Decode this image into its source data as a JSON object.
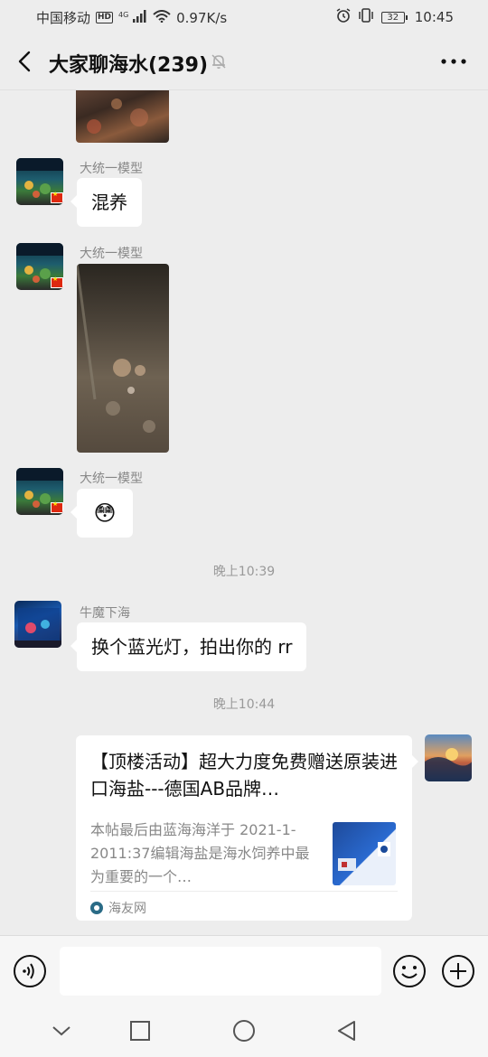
{
  "status_bar": {
    "carrier": "中国移动",
    "hd": "HD",
    "network": "4G",
    "speed": "0.97K/s",
    "battery": "32",
    "time": "10:45"
  },
  "header": {
    "title": "大家聊海水(239)"
  },
  "messages": [
    {
      "sender": "大统一模型",
      "text": "混养"
    },
    {
      "sender": "大统一模型"
    },
    {
      "sender": "大统一模型",
      "text": "😳"
    },
    {
      "sender": "牛魔下海",
      "text": "换个蓝光灯，拍出你的 rr"
    }
  ],
  "time_separators": [
    "晚上10:39",
    "晚上10:44"
  ],
  "link_card": {
    "title": "【顶楼活动】超大力度免费赠送原装进口海盐---德国AB品牌…",
    "description": "本帖最后由蓝海海洋于 2021-1-2011:37编辑海盐是海水饲养中最为重要的一个…",
    "source": "海友网"
  },
  "input": {
    "value": ""
  },
  "colors": {
    "background": "#ededed",
    "bubble": "#ffffff",
    "separator_text": "#999999"
  },
  "icons": [
    "back-arrow-icon",
    "mute-icon",
    "more-icon",
    "voice-icon",
    "emoji-icon",
    "plus-icon",
    "nav-down-icon",
    "nav-square-icon",
    "nav-circle-icon",
    "nav-back-icon"
  ]
}
